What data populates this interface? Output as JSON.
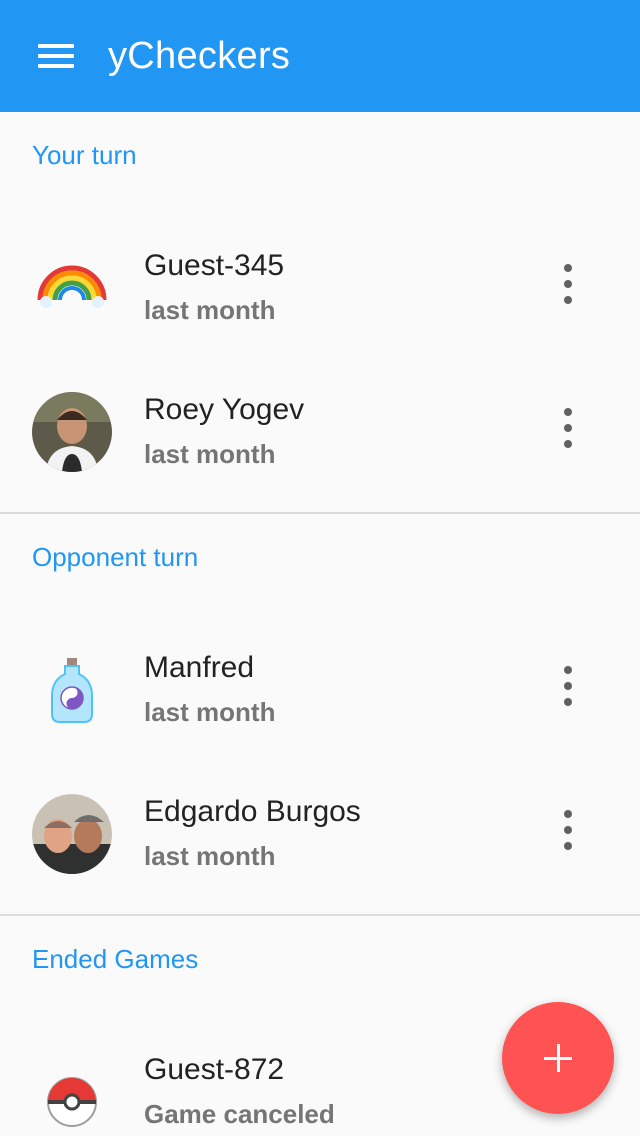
{
  "app": {
    "title": "yCheckers",
    "primary_color": "#2196f3",
    "fab_color": "#ff5252"
  },
  "sections": [
    {
      "title": "Your turn",
      "items": [
        {
          "name": "Guest-345",
          "sub": "last month",
          "avatar": "rainbow-avatar"
        },
        {
          "name": "Roey Yogev",
          "sub": "last month",
          "avatar": "photo-avatar"
        }
      ]
    },
    {
      "title": "Opponent turn",
      "items": [
        {
          "name": "Manfred",
          "sub": "last month",
          "avatar": "bottle-avatar"
        },
        {
          "name": "Edgardo Burgos",
          "sub": "last month",
          "avatar": "photo-avatar"
        }
      ]
    },
    {
      "title": "Ended Games",
      "items": [
        {
          "name": "Guest-872",
          "sub": "Game canceled",
          "avatar": "pokeball-avatar"
        }
      ]
    }
  ],
  "icons": {
    "menu": "menu-icon",
    "more": "more-vert-icon",
    "fab": "plus-icon"
  }
}
